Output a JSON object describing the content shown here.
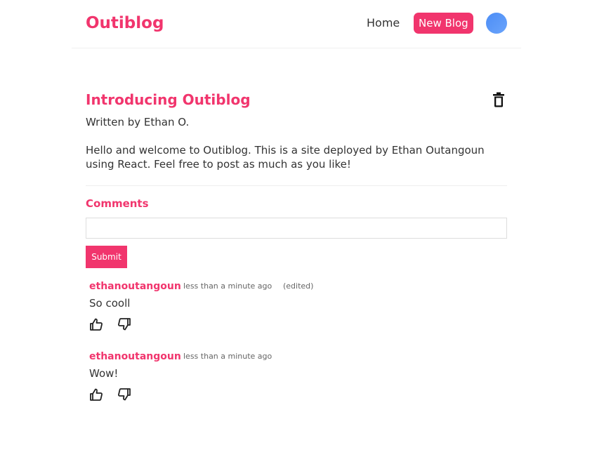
{
  "nav": {
    "brand": "Outiblog",
    "links": {
      "home": "Home",
      "new_blog": "New Blog"
    },
    "avatar_icon": "user-avatar"
  },
  "blog": {
    "title": "Introducing Outiblog",
    "author_line": "Written by Ethan O.",
    "body": "Hello and welcome to Outiblog. This is a site deployed by Ethan Outangoun using React. Feel free to post as much as you like!",
    "delete_icon": "trash-icon"
  },
  "comments_section": {
    "heading": "Comments",
    "input_value": "",
    "submit_label": "Submit",
    "items": [
      {
        "user": "ethanoutangoun",
        "time": "less than a minute ago",
        "edited": "(edited)",
        "text": "So cooll",
        "like_icon": "thumb-up-icon",
        "dislike_icon": "thumb-down-icon"
      },
      {
        "user": "ethanoutangoun",
        "time": "less than a minute ago",
        "edited": "",
        "text": "Wow!",
        "like_icon": "thumb-up-icon",
        "dislike_icon": "thumb-down-icon"
      }
    ]
  },
  "colors": {
    "accent": "#f1356d",
    "text": "#333333",
    "muted": "#666666",
    "avatar": "#5a98f8"
  }
}
